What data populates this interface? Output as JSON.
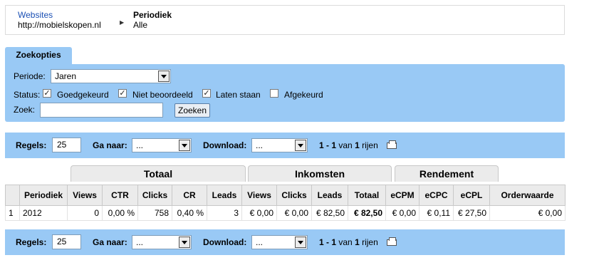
{
  "breadcrumb": {
    "websites_label": "Websites",
    "website_url": "http://mobielskopen.nl",
    "periodiek_label": "Periodiek",
    "periodiek_value": "Alle"
  },
  "search": {
    "tab_label": "Zoekopties",
    "periode_label": "Periode:",
    "periode_value": "Jaren",
    "status_label": "Status:",
    "statuses": [
      {
        "label": "Goedgekeurd",
        "checked": true
      },
      {
        "label": "Niet beoordeeld",
        "checked": true
      },
      {
        "label": "Laten staan",
        "checked": true
      },
      {
        "label": "Afgekeurd",
        "checked": false
      }
    ],
    "zoek_label": "Zoek:",
    "zoek_value": "",
    "button_label": "Zoeken"
  },
  "pager": {
    "regels_label": "Regels:",
    "regels_value": "25",
    "ganaar_label": "Ga naar:",
    "ganaar_value": "...",
    "download_label": "Download:",
    "download_value": "...",
    "range": "1 - 1",
    "van": "van",
    "total": "1",
    "rijen": "rijen",
    "printer_icon": "printer-icon"
  },
  "table": {
    "groups": [
      "Totaal",
      "Inkomsten",
      "Rendement"
    ],
    "headers": [
      "",
      "Periodiek",
      "Views",
      "CTR",
      "Clicks",
      "CR",
      "Leads",
      "Views",
      "Clicks",
      "Leads",
      "Totaal",
      "eCPM",
      "eCPC",
      "eCPL",
      "Orderwaarde"
    ],
    "rows": [
      [
        "1",
        "2012",
        "0",
        "0,00 %",
        "758",
        "0,40 %",
        "3",
        "€ 0,00",
        "€ 0,00",
        "€ 82,50",
        "€ 82,50",
        "€ 0,00",
        "€ 0,11",
        "€ 27,50",
        "€ 0,00"
      ]
    ]
  }
}
